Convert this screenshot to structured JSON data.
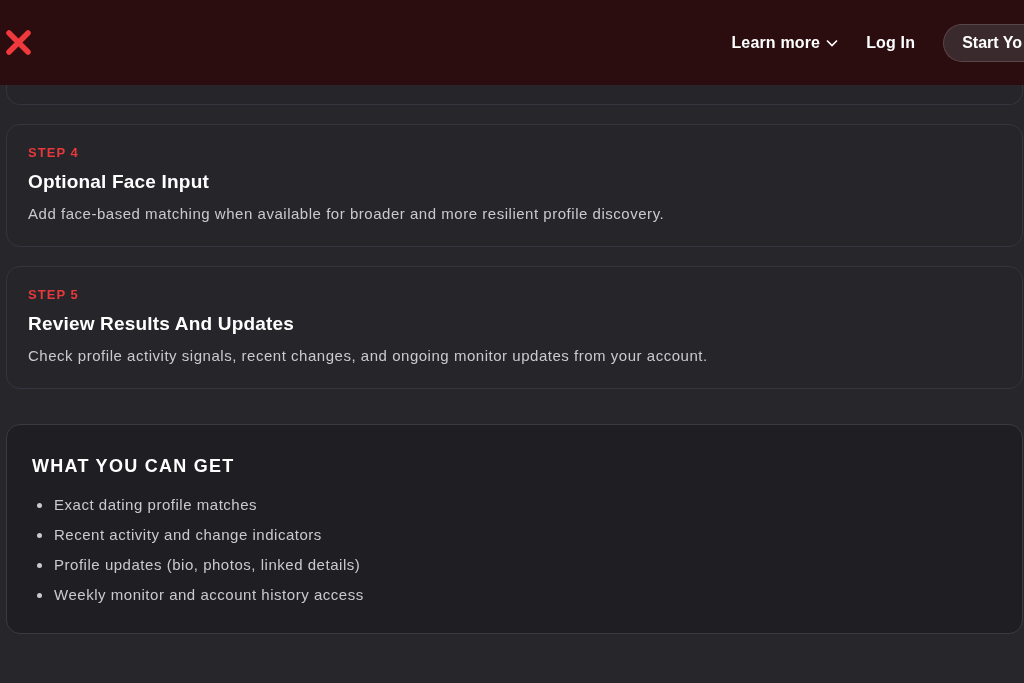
{
  "header": {
    "nav": [
      {
        "kind": "dropdown",
        "label": "Learn more"
      },
      {
        "kind": "link",
        "label": "Log In"
      }
    ],
    "cta": {
      "label": "Start Yo"
    }
  },
  "steps": [
    {
      "step": "STEP 4",
      "title": "Optional Face Input",
      "description": "Add face-based matching when available for broader and more resilient profile discovery."
    },
    {
      "step": "STEP 5",
      "title": "Review Results And Updates",
      "description": "Check profile activity signals, recent changes, and ongoing monitor updates from your account."
    }
  ],
  "benefits": {
    "title": "WHAT YOU CAN GET",
    "items": [
      "Exact dating profile matches",
      "Recent activity and change indicators",
      "Profile updates (bio, photos, linked details)",
      "Weekly monitor and account history access"
    ]
  }
}
